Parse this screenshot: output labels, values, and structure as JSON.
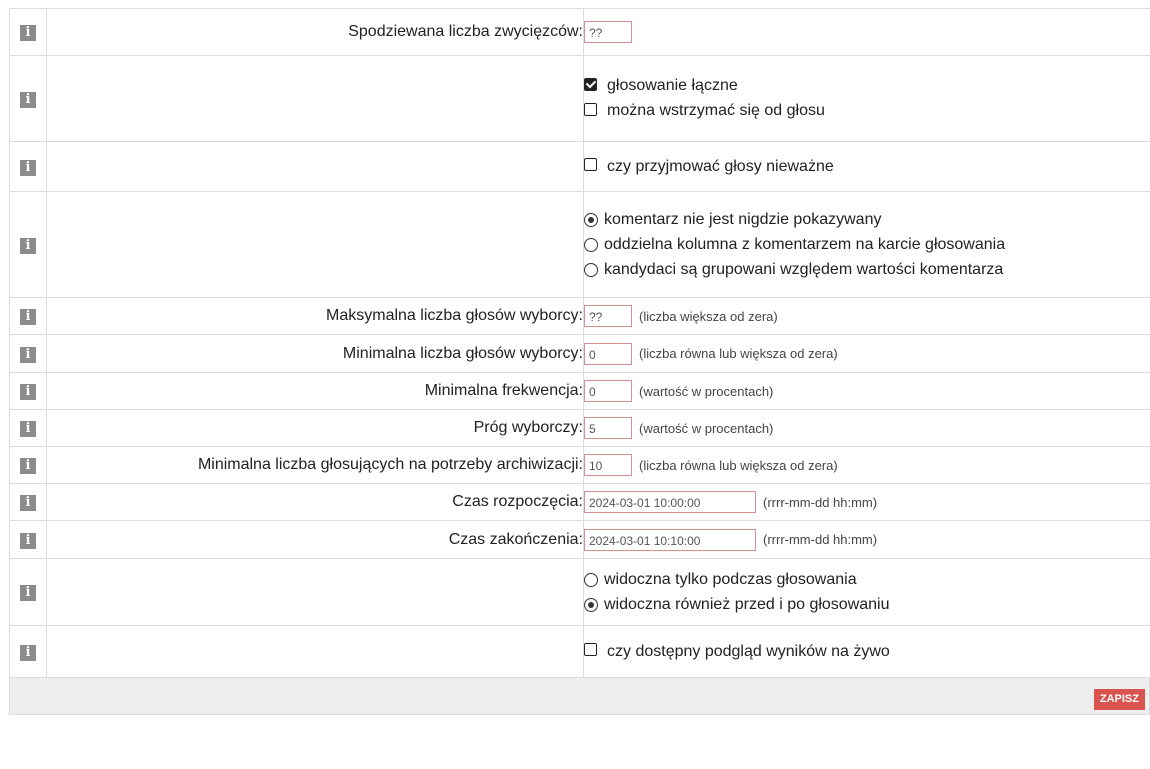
{
  "rows": {
    "expected_winners": {
      "label": "Spodziewana liczba zwycięzców:",
      "value": "??"
    },
    "options1": {
      "cumulative_voting": {
        "label": "głosowanie łączne",
        "checked": true
      },
      "abstain": {
        "label": "można wstrzymać się od głosu",
        "checked": false
      }
    },
    "invalid_votes": {
      "label": "czy przyjmować głosy nieważne",
      "checked": false
    },
    "comment": {
      "options": [
        {
          "label": "komentarz nie jest nigdzie pokazywany",
          "selected": true
        },
        {
          "label": "oddzielna kolumna z komentarzem na karcie głosowania",
          "selected": false
        },
        {
          "label": "kandydaci są grupowani względem wartości komentarza",
          "selected": false
        }
      ]
    },
    "max_votes": {
      "label": "Maksymalna liczba głosów wyborcy:",
      "value": "??",
      "hint": "(liczba większa od zera)"
    },
    "min_votes": {
      "label": "Minimalna liczba głosów wyborcy:",
      "value": "0",
      "hint": "(liczba równa lub większa od zera)"
    },
    "min_turnout": {
      "label": "Minimalna frekwencja:",
      "value": "0",
      "hint": "(wartość w procentach)"
    },
    "threshold": {
      "label": "Próg wyborczy:",
      "value": "5",
      "hint": "(wartość w procentach)"
    },
    "min_archive": {
      "label": "Minimalna liczba głosujących na potrzeby archiwizacji:",
      "value": "10",
      "hint": "(liczba równa lub większa od zera)"
    },
    "start_time": {
      "label": "Czas rozpoczęcia:",
      "value": "2024-03-01 10:00:00",
      "hint": "(rrrr-mm-dd hh:mm)"
    },
    "end_time": {
      "label": "Czas zakończenia:",
      "value": "2024-03-01 10:10:00",
      "hint": "(rrrr-mm-dd hh:mm)"
    },
    "visibility": {
      "options": [
        {
          "label": "widoczna tylko podczas głosowania",
          "selected": false
        },
        {
          "label": "widoczna również przed i po głosowaniu",
          "selected": true
        }
      ]
    },
    "live_preview": {
      "label": "czy dostępny podgląd wyników na żywo",
      "checked": false
    }
  },
  "info_icon_glyph": "i",
  "save_label": "ZAPISZ",
  "colors": {
    "accent": "#d9534f",
    "icon": "#8c8c8c",
    "input_border": "#d59090"
  }
}
